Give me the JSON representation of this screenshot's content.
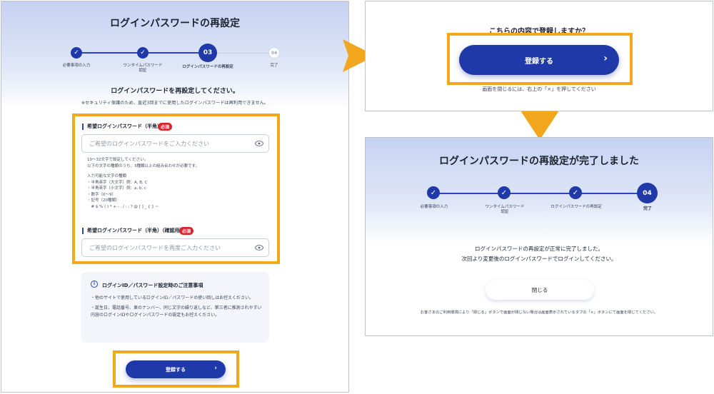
{
  "left": {
    "title": "ログインパスワードの再設定",
    "steps": [
      {
        "num": "✓",
        "label": "必要事項の入力"
      },
      {
        "num": "✓",
        "label": "ワンタイムパスワード\n認証"
      },
      {
        "num": "03",
        "label": "ログインパスワードの再設定"
      },
      {
        "num": "04",
        "label": "完了"
      }
    ],
    "heading": "ログインパスワードを再設定してください。",
    "note": "※セキュリティ保護のため、直近3回までに使用したログインパスワードは再利用できません。",
    "field1": {
      "label": "希望ログインパスワード（半角）",
      "required": "必須",
      "placeholder": "ご希望のログインパスワードをご入力ください"
    },
    "hints": [
      "10〜32文字で設定してください。",
      "以下の文字の種類のうち、3種類以上の組み合わせが必要です。",
      "",
      "入力可能な文字の種類",
      "・半角英字（大文字）例：A, B, C",
      "・半角英字（小文字）例：a, b, c",
      "・数字（0〜9）",
      "・記号（20種類）",
      "　# $ % ( ) * + - . / : ; ? @ [ ] _ { } ~"
    ],
    "field2": {
      "label": "希望ログインパスワード（半角）（確認用）",
      "required": "必須",
      "placeholder": "ご希望のログインパスワードを再度ご入力ください"
    },
    "notice": {
      "title": "ログインID／パスワード設定時のご注意事項",
      "item1": "・他のサイトで使用しているログインID／パスワードの使い回しはお控えください。",
      "item2": "・誕生日、電話番号、車のナンバー、同じ文字の繰り返しなど、第三者に推測されやすい内容のログインIDやログインパスワードの設定もお控えください。"
    },
    "submit": "登録する"
  },
  "confirm": {
    "question": "こちらの内容で登録しますか？",
    "submit": "登録する",
    "close_hint": "画面を閉じるには、右上の「×」を押してください"
  },
  "complete": {
    "title": "ログインパスワードの再設定が完了しました",
    "steps": [
      {
        "num": "✓",
        "label": "必要事項の入力"
      },
      {
        "num": "✓",
        "label": "ワンタイムパスワード\n認証"
      },
      {
        "num": "✓",
        "label": "ログインパスワードの再設定"
      },
      {
        "num": "04",
        "label": "完了"
      }
    ],
    "message1": "ログインパスワードの再設定が正常に完了しました。",
    "message2": "次回より変更後のログインパスワードでログインしてください。",
    "close_button": "閉じる",
    "footnote": "お客さまのご利用環境により「閉じる」ボタンで画面が閉じない場合は画面表示されているタブの「×」ボタンにて画面を閉じてください。"
  },
  "colors": {
    "accent": "#1f3aa8",
    "highlight": "#f0a81c",
    "required": "#d6262b"
  }
}
